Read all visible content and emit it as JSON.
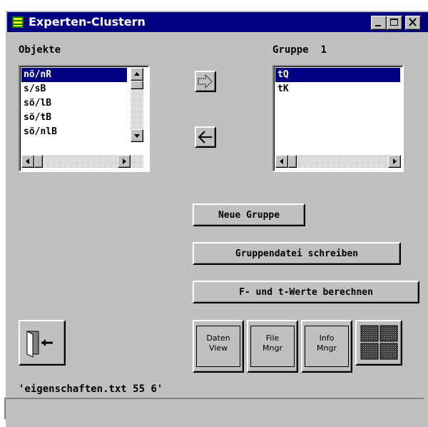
{
  "window": {
    "title": "Experten-Clustern"
  },
  "left_panel": {
    "label": "Objekte",
    "items": [
      "nö/nR",
      "s/sB",
      "sö/lB",
      "sö/tB",
      "sö/nlB"
    ],
    "selected_index": 0
  },
  "right_panel": {
    "label_prefix": "Gruppe",
    "group_number": "1",
    "items": [
      "tQ",
      "tK"
    ],
    "selected_index": 0
  },
  "buttons": {
    "new_group": "Neue Gruppe",
    "write_group_file": "Gruppendatei schreiben",
    "compute_values": "F- und t-Werte berechnen"
  },
  "tool_buttons": {
    "data_view": [
      "Daten",
      "View"
    ],
    "file_mngr": [
      "File",
      "Mngr"
    ],
    "info_mngr": [
      "Info",
      "Mngr"
    ]
  },
  "status_line": "'eigenschaften.txt 55 6'",
  "colors": {
    "title_bar": "#000080",
    "face": "#c0c0c0",
    "selection": "#000080"
  }
}
